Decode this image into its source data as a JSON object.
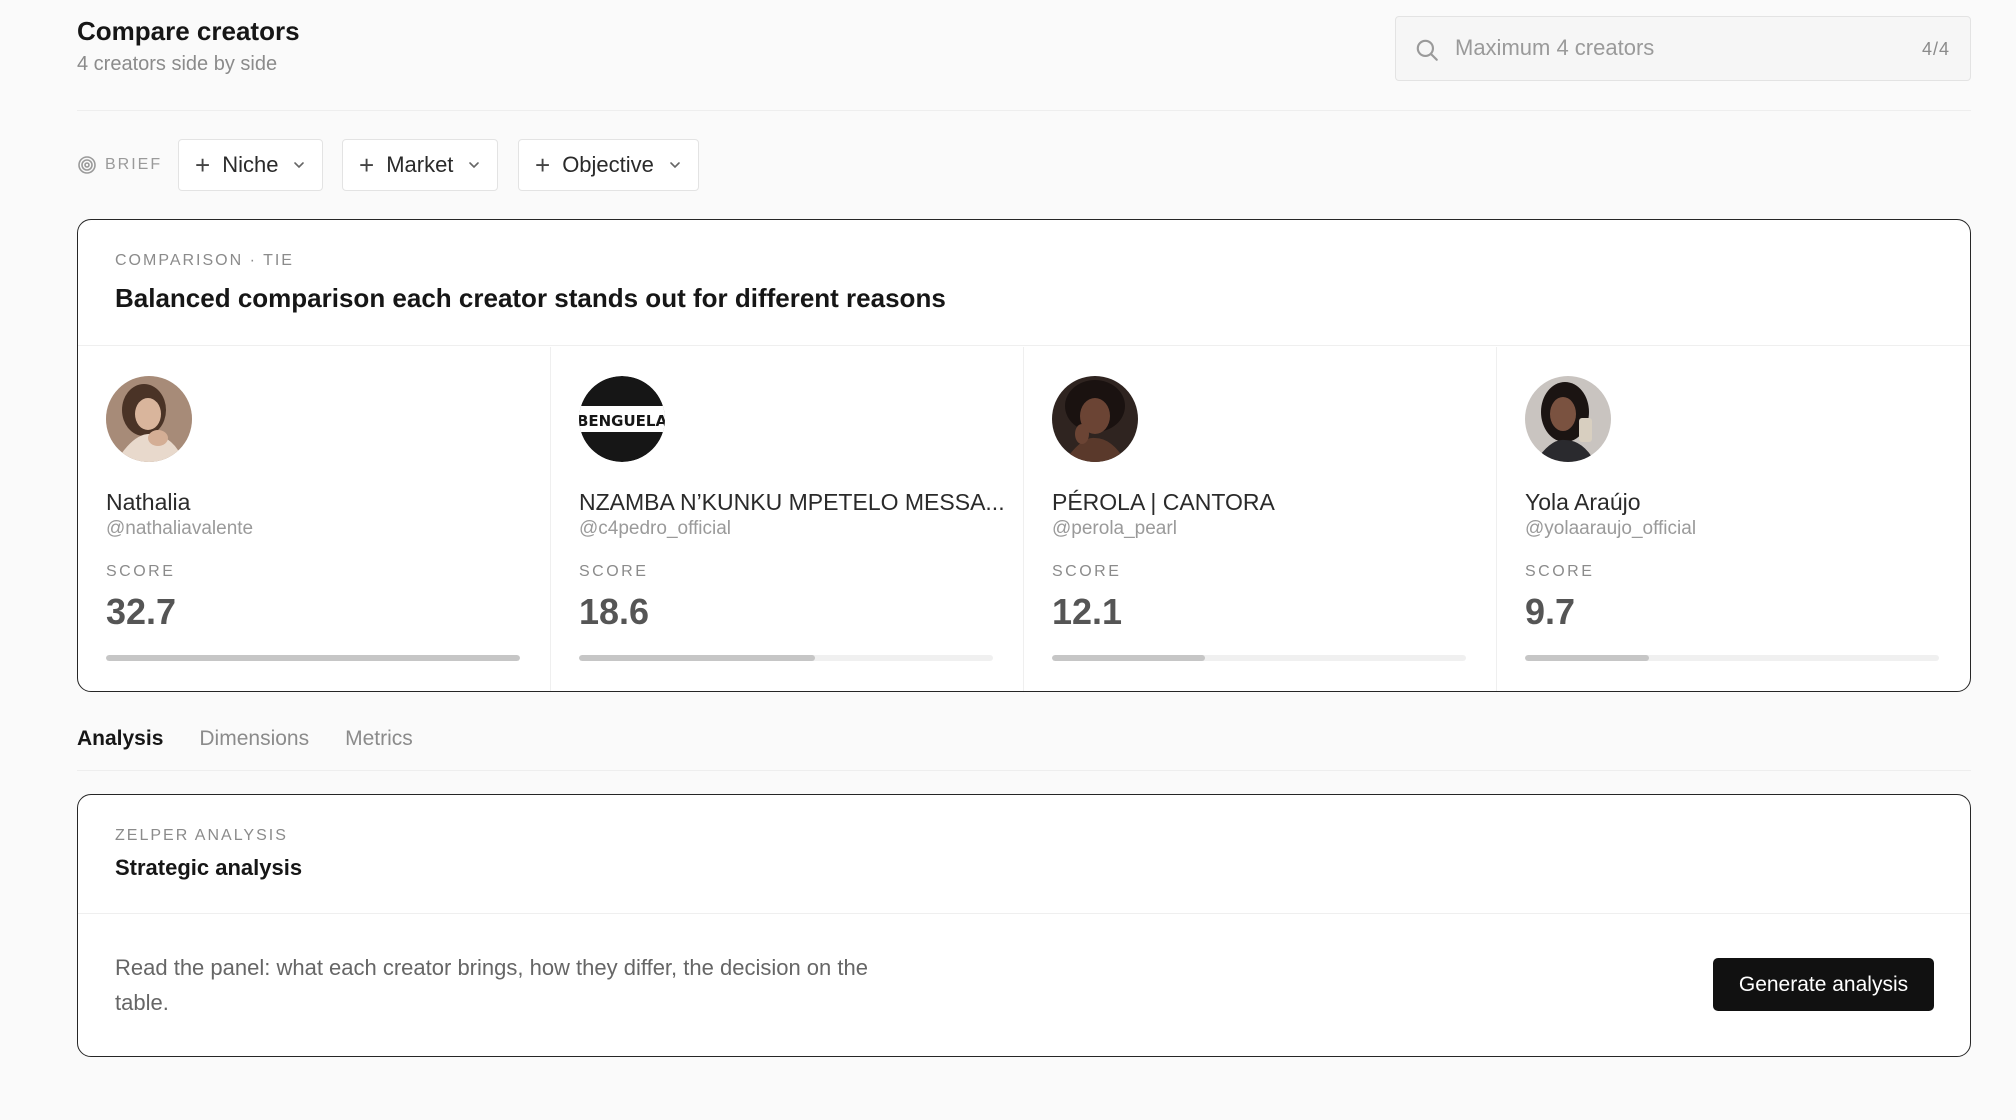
{
  "header": {
    "title": "Compare creators",
    "subtitle": "4 creators side by side",
    "search": {
      "placeholder": "Maximum 4 creators",
      "count": "4/4",
      "icon": "search-icon"
    }
  },
  "brief": {
    "label": "BRIEF",
    "icon": "target-icon",
    "chips": [
      {
        "label": "Niche"
      },
      {
        "label": "Market"
      },
      {
        "label": "Objective"
      }
    ]
  },
  "comparison": {
    "kicker": "COMPARISON · TIE",
    "title": "Balanced comparison each creator stands out for different reasons",
    "score_label": "SCORE",
    "creators": [
      {
        "name": "Nathalia",
        "handle": "@nathaliavalente",
        "score": "32.7",
        "score_fraction": 1.0,
        "avatar": "portrait-photo"
      },
      {
        "name": "NZAMBA N’KUNKU MPETELO MESSA...",
        "handle": "@c4pedro_official",
        "score": "18.6",
        "score_fraction": 0.57,
        "avatar": "benguela-logo",
        "avatar_text": "BENGUELA"
      },
      {
        "name": "PÉROLA | CANTORA",
        "handle": "@perola_pearl",
        "score": "12.1",
        "score_fraction": 0.37,
        "avatar": "portrait-photo"
      },
      {
        "name": "Yola Araújo",
        "handle": "@yolaaraujo_official",
        "score": "9.7",
        "score_fraction": 0.3,
        "avatar": "portrait-photo"
      }
    ]
  },
  "tabs": [
    {
      "label": "Analysis",
      "active": true
    },
    {
      "label": "Dimensions",
      "active": false
    },
    {
      "label": "Metrics",
      "active": false
    }
  ],
  "analysis": {
    "kicker": "ZELPER ANALYSIS",
    "title": "Strategic analysis",
    "text": "Read the panel: what each creator brings, how they differ, the decision on the table.",
    "button": "Generate analysis"
  },
  "colors": {
    "accent": "#111111",
    "card_border": "#262626",
    "bar_fill": "#c6c6c6",
    "bar_track": "#f0f0f0",
    "muted_text": "#8b8b8b"
  }
}
